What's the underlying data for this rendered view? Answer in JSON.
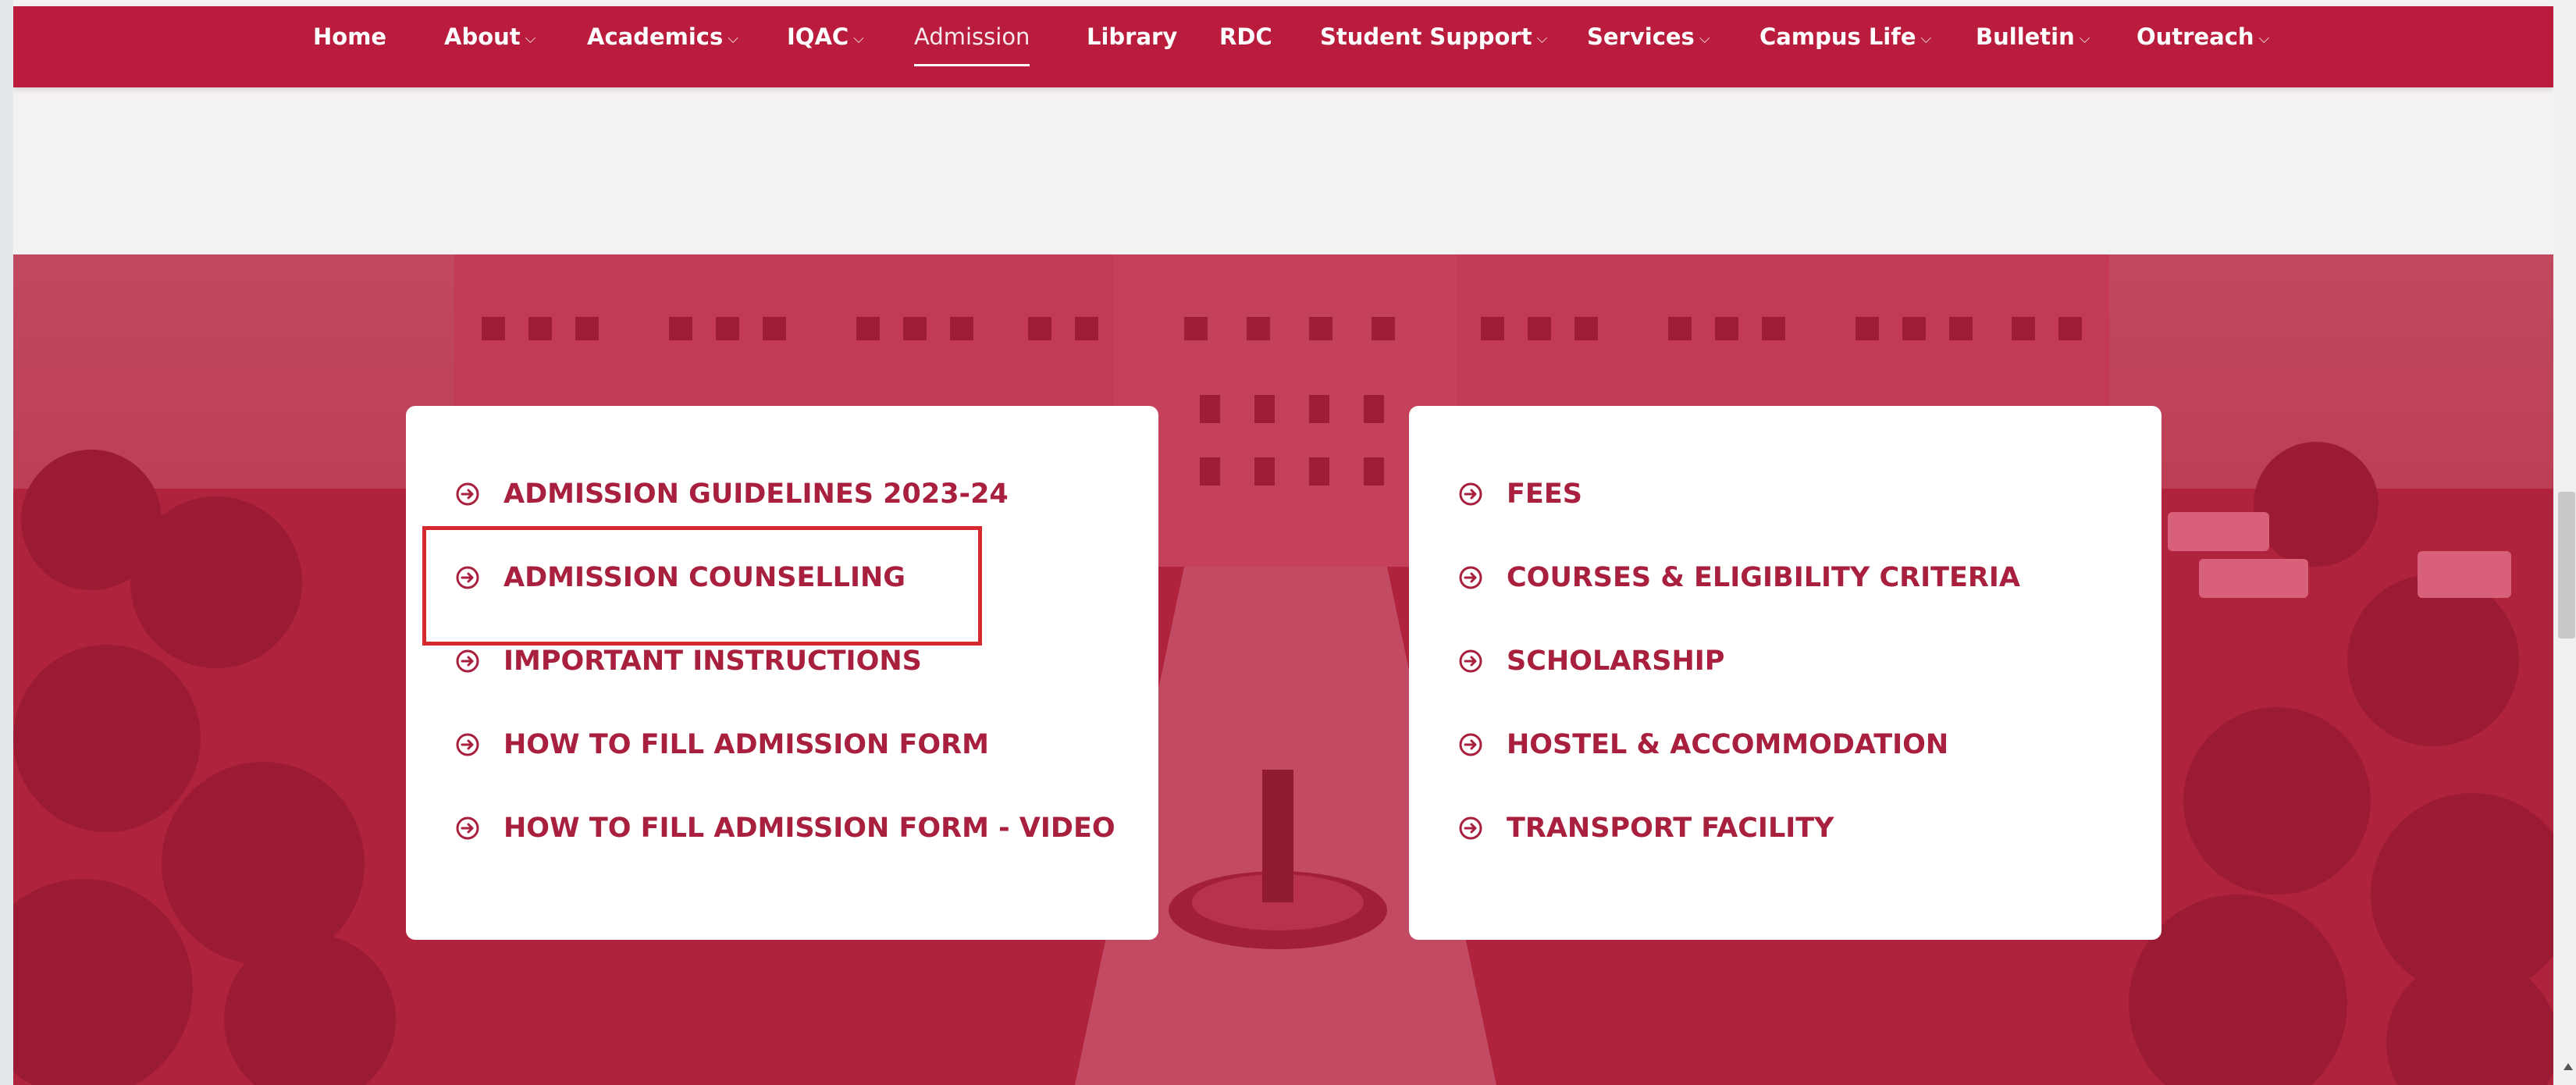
{
  "nav": {
    "items": [
      {
        "label": "Home",
        "has_dropdown": false
      },
      {
        "label": "About",
        "has_dropdown": true
      },
      {
        "label": "Academics",
        "has_dropdown": true
      },
      {
        "label": "IQAC",
        "has_dropdown": true
      },
      {
        "label": "Admission",
        "has_dropdown": false,
        "active": true
      },
      {
        "label": "Library",
        "has_dropdown": false
      },
      {
        "label": "RDC",
        "has_dropdown": false
      },
      {
        "label": "Student Support",
        "has_dropdown": true
      },
      {
        "label": "Services",
        "has_dropdown": true
      },
      {
        "label": "Campus Life",
        "has_dropdown": true
      },
      {
        "label": "Bulletin",
        "has_dropdown": true
      },
      {
        "label": "Outreach",
        "has_dropdown": true
      }
    ],
    "dropdown_icon": "chevron-down-icon"
  },
  "admission_links": {
    "left": [
      "ADMISSION GUIDELINES 2023-24",
      "ADMISSION COUNSELLING",
      "IMPORTANT INSTRUCTIONS",
      "HOW TO FILL ADMISSION FORM",
      "HOW TO FILL ADMISSION FORM - VIDEO"
    ],
    "right": [
      "FEES",
      "COURSES & ELIGIBILITY CRITERIA",
      "SCHOLARSHIP",
      "HOSTEL & ACCOMMODATION",
      "TRANSPORT FACILITY"
    ],
    "link_icon": "circle-arrow-right-icon",
    "highlighted": "ADMISSION COUNSELLING"
  },
  "colors": {
    "brand": "#b91c3d",
    "link_text": "#a8203e",
    "highlight_border": "#d6282f",
    "page_background": "#f4f1f1"
  }
}
